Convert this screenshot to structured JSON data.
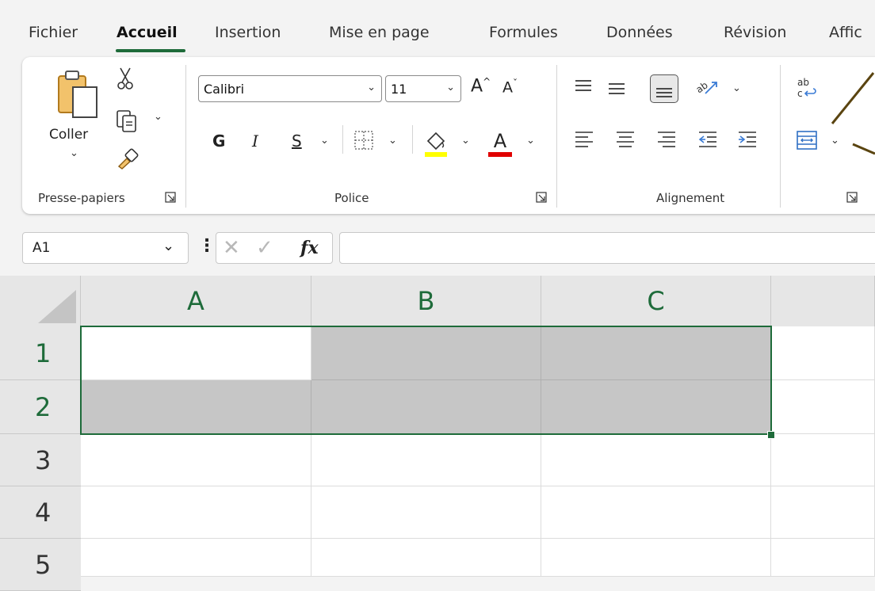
{
  "tabs": [
    {
      "label": "Fichier"
    },
    {
      "label": "Accueil"
    },
    {
      "label": "Insertion"
    },
    {
      "label": "Mise en page"
    },
    {
      "label": "Formules"
    },
    {
      "label": "Données"
    },
    {
      "label": "Révision"
    },
    {
      "label": "Affic"
    }
  ],
  "clipboard": {
    "paste_label": "Coller",
    "group_label": "Presse-papiers"
  },
  "font": {
    "name_value": "Calibri",
    "size_value": "11",
    "bold_label": "G",
    "italic_label": "I",
    "underline_label": "S",
    "fill_color": "#ffff00",
    "font_color": "#e00000",
    "group_label": "Police"
  },
  "alignment": {
    "group_label": "Alignement"
  },
  "formula_bar": {
    "name_box": "A1",
    "fx_label": "fx",
    "formula": ""
  },
  "grid": {
    "columns": [
      "A",
      "B",
      "C"
    ],
    "rows": [
      "1",
      "2",
      "3",
      "4",
      "5"
    ],
    "selection_color": "#1e6b3a"
  }
}
